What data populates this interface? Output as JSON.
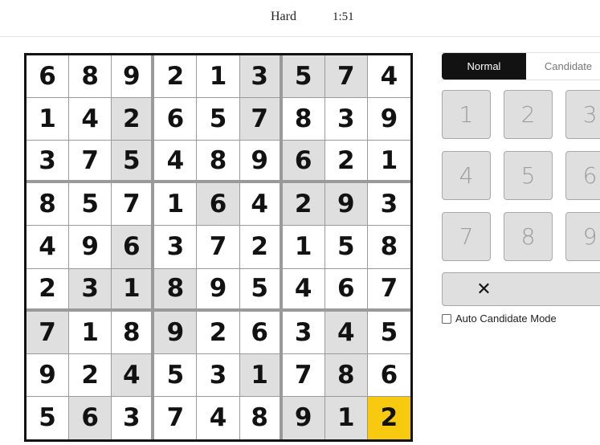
{
  "header": {
    "difficulty": "Hard",
    "timer": "1:51"
  },
  "board": {
    "rows": [
      [
        "6",
        "8",
        "9",
        "2",
        "1",
        "3",
        "5",
        "7",
        "4"
      ],
      [
        "1",
        "4",
        "2",
        "6",
        "5",
        "7",
        "8",
        "3",
        "9"
      ],
      [
        "3",
        "7",
        "5",
        "4",
        "8",
        "9",
        "6",
        "2",
        "1"
      ],
      [
        "8",
        "5",
        "7",
        "1",
        "6",
        "4",
        "2",
        "9",
        "3"
      ],
      [
        "4",
        "9",
        "6",
        "3",
        "7",
        "2",
        "1",
        "5",
        "8"
      ],
      [
        "2",
        "3",
        "1",
        "8",
        "9",
        "5",
        "4",
        "6",
        "7"
      ],
      [
        "7",
        "1",
        "8",
        "9",
        "2",
        "6",
        "3",
        "4",
        "5"
      ],
      [
        "9",
        "2",
        "4",
        "5",
        "3",
        "1",
        "7",
        "8",
        "6"
      ],
      [
        "5",
        "6",
        "3",
        "7",
        "4",
        "8",
        "9",
        "1",
        "2"
      ]
    ],
    "highlighted": [
      [
        0,
        5
      ],
      [
        0,
        6
      ],
      [
        0,
        7
      ],
      [
        1,
        2
      ],
      [
        1,
        5
      ],
      [
        2,
        2
      ],
      [
        2,
        6
      ],
      [
        3,
        4
      ],
      [
        3,
        6
      ],
      [
        3,
        7
      ],
      [
        4,
        2
      ],
      [
        5,
        1
      ],
      [
        5,
        2
      ],
      [
        5,
        3
      ],
      [
        6,
        0
      ],
      [
        6,
        3
      ],
      [
        6,
        7
      ],
      [
        7,
        2
      ],
      [
        7,
        5
      ],
      [
        7,
        7
      ],
      [
        8,
        1
      ],
      [
        8,
        6
      ],
      [
        8,
        7
      ]
    ],
    "selected": [
      8,
      8
    ],
    "colors": {
      "highlight": "#dfdfdf",
      "selected": "#f7c90f"
    }
  },
  "controls": {
    "modes": [
      {
        "label": "Normal",
        "active": true
      },
      {
        "label": "Candidate",
        "active": false
      }
    ],
    "pad": [
      "1",
      "2",
      "3",
      "4",
      "5",
      "6",
      "7",
      "8",
      "9"
    ],
    "erase_icon": "close-icon",
    "erase_symbol": "✕",
    "auto_candidate": {
      "label": "Auto Candidate Mode",
      "checked": false
    }
  }
}
